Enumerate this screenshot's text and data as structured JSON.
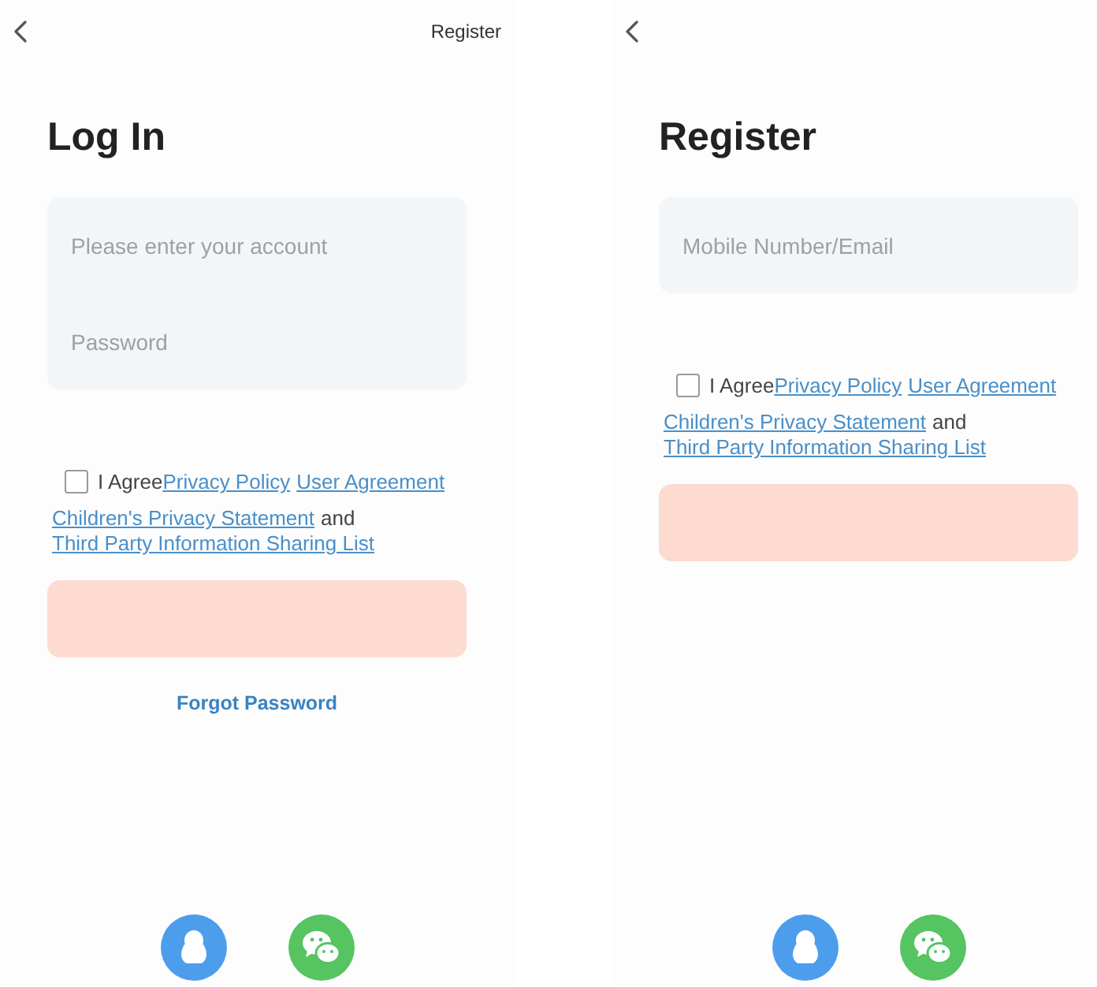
{
  "screens": [
    {
      "header_action": "Register",
      "title": "Log In",
      "fields": [
        {
          "placeholder": "Please enter your account"
        },
        {
          "placeholder": "Password"
        }
      ],
      "agreement": {
        "checked": false,
        "lines": [
          [
            {
              "text": "I Agree",
              "kind": "text"
            },
            {
              "text": "Privacy Policy",
              "kind": "link"
            },
            {
              "text": "User Agreement",
              "kind": "link"
            }
          ],
          [
            {
              "text": "Children's Privacy Statement",
              "kind": "link"
            },
            {
              "text": "and",
              "kind": "text"
            }
          ],
          [
            {
              "text": "Third Party Information Sharing List",
              "kind": "link"
            }
          ]
        ]
      },
      "submit": {
        "disabled": true
      },
      "footer_link": "Forgot Password",
      "social": [
        {
          "kind": "penguin"
        },
        {
          "kind": "chat"
        }
      ]
    },
    {
      "title": "Register",
      "fields": [
        {
          "placeholder": "Mobile Number/Email"
        }
      ],
      "agreement": {
        "checked": false,
        "lines": [
          [
            {
              "text": "I Agree",
              "kind": "text"
            },
            {
              "text": "Privacy Policy",
              "kind": "link"
            },
            {
              "text": "User Agreement",
              "kind": "link"
            }
          ],
          [
            {
              "text": "Children's Privacy Statement",
              "kind": "link"
            },
            {
              "text": "and",
              "kind": "text"
            }
          ],
          [
            {
              "text": "Third Party Information Sharing List",
              "kind": "link"
            }
          ]
        ]
      },
      "submit": {
        "disabled": true
      },
      "social": [
        {
          "kind": "penguin"
        },
        {
          "kind": "chat"
        }
      ]
    }
  ]
}
